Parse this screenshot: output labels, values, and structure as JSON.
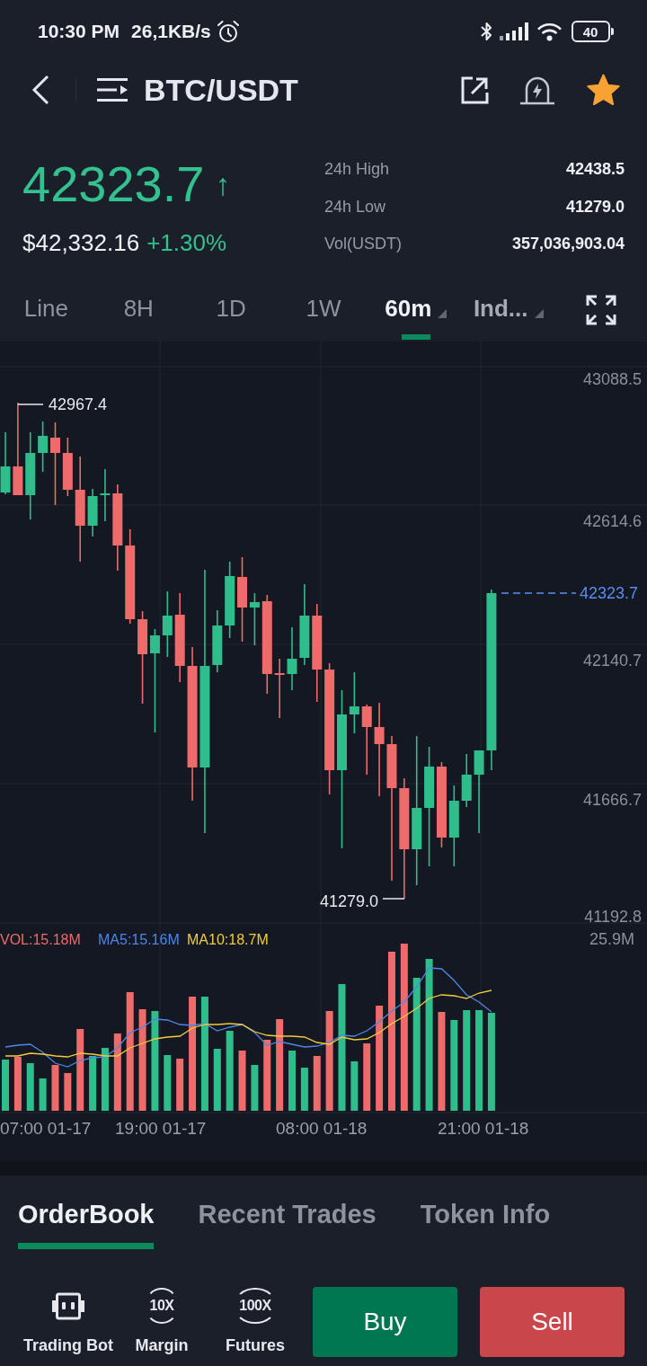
{
  "status_bar": {
    "time": "10:30 PM",
    "network_speed": "26,1KB/s",
    "battery": "40"
  },
  "header": {
    "title": "BTC/USDT",
    "favorite": true
  },
  "ticker": {
    "price": "42323.7",
    "rising": true,
    "arrow": "↑",
    "fiat_price": "$42,332.16",
    "change": "+1.30%",
    "stats": [
      {
        "label": "24h High",
        "value": "42438.5"
      },
      {
        "label": "24h Low",
        "value": "41279.0"
      },
      {
        "label": "Vol(USDT)",
        "value": "357,036,903.04"
      }
    ]
  },
  "intervals": [
    {
      "label": "Line",
      "kind": "tab",
      "selected": false
    },
    {
      "label": "8H",
      "kind": "tab",
      "selected": false
    },
    {
      "label": "1D",
      "kind": "tab",
      "selected": false
    },
    {
      "label": "1W",
      "kind": "tab",
      "selected": false
    },
    {
      "label": "60m",
      "kind": "dropdown",
      "selected": true
    },
    {
      "label": "Ind...",
      "kind": "dropdown",
      "selected": false
    }
  ],
  "chart": {
    "price_axis": [
      "43088.5",
      "42614.6",
      "42140.7",
      "41666.7",
      "41192.8"
    ],
    "high_marker": "42967.4",
    "low_marker": "41279.0",
    "last_price": "42323.7",
    "volume_legend": [
      {
        "kind": "vol",
        "text": "VOL:15.18M",
        "color": "#ee6b6b"
      },
      {
        "kind": "ma5",
        "text": "MA5:15.16M",
        "color": "#4d86e8"
      },
      {
        "kind": "ma10",
        "text": "MA10:18.7M",
        "color": "#f2cc3c"
      }
    ],
    "volume_axis": "25.9M",
    "time_axis": [
      "07:00 01-17",
      "19:00 01-17",
      "08:00 01-18",
      "21:00 01-18"
    ]
  },
  "info_tabs": [
    {
      "label": "OrderBook",
      "selected": true
    },
    {
      "label": "Recent Trades",
      "selected": false
    },
    {
      "label": "Token Info",
      "selected": false
    }
  ],
  "shortcuts": [
    {
      "kind": "bot",
      "label": "Trading Bot"
    },
    {
      "kind": "leverage",
      "badge": "10X",
      "label": "Margin"
    },
    {
      "kind": "leverage",
      "badge": "100X",
      "label": "Futures"
    }
  ],
  "trade_buttons": [
    {
      "kind": "buy",
      "label": "Buy"
    },
    {
      "kind": "sell",
      "label": "Sell"
    }
  ]
}
